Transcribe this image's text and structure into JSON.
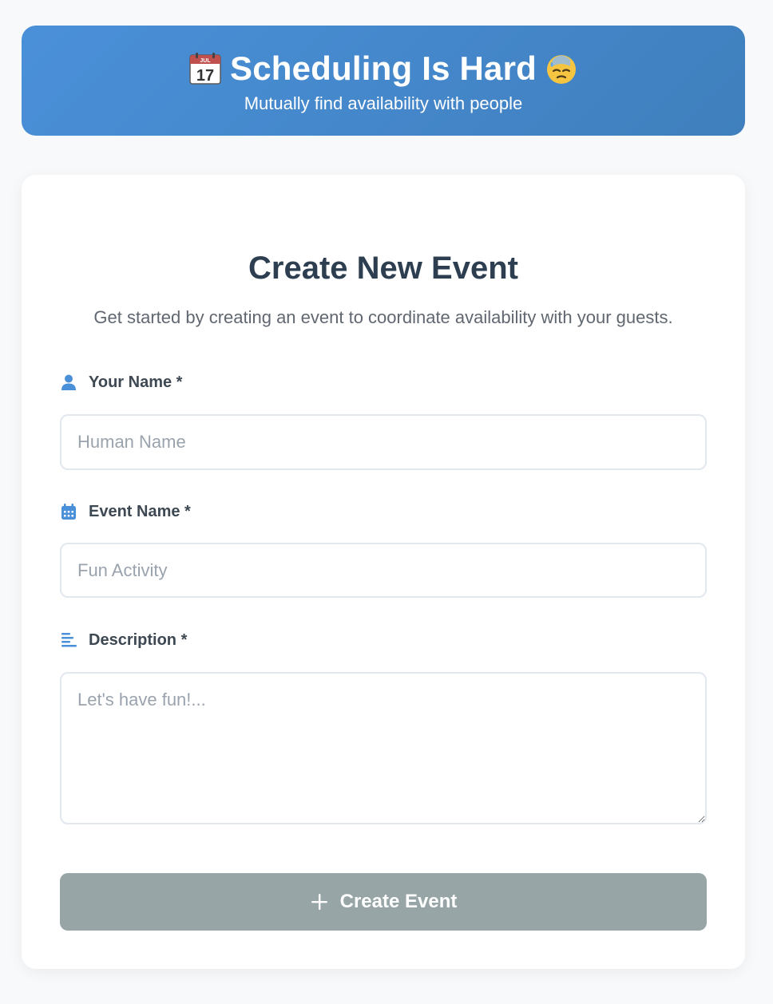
{
  "header": {
    "calendar_emoji_month": "JUL",
    "calendar_emoji_day": "17",
    "title": "Scheduling Is Hard",
    "subtitle": "Mutually find availability with people"
  },
  "form": {
    "title": "Create New Event",
    "description": "Get started by creating an event to coordinate availability with your guests.",
    "fields": {
      "your_name": {
        "label": "Your Name *",
        "placeholder": "Human Name",
        "icon": "user-icon"
      },
      "event_name": {
        "label": "Event Name *",
        "placeholder": "Fun Activity",
        "icon": "calendar-icon"
      },
      "description": {
        "label": "Description *",
        "placeholder": "Let's have fun!...",
        "icon": "align-left-icon"
      }
    },
    "submit_label": "Create Event",
    "submit_icon": "plus-icon"
  },
  "colors": {
    "header_gradient_start": "#4a90d9",
    "header_gradient_end": "#3f7fbd",
    "icon_accent": "#4a90d9",
    "button_disabled": "#97a5a6",
    "title_text": "#2c3e50"
  }
}
